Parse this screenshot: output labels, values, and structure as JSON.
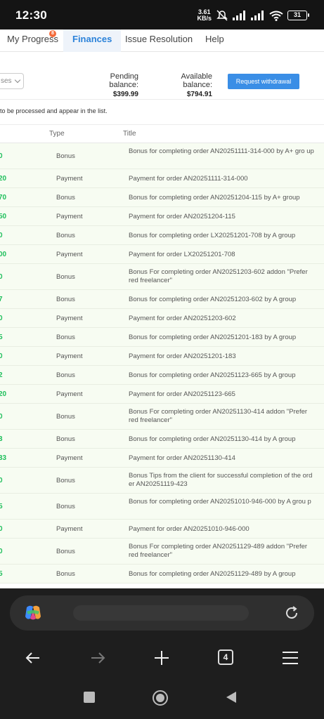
{
  "status_bar": {
    "time": "12:30",
    "net_speed_value": "3.61",
    "net_speed_unit": "KB/s",
    "battery": "31"
  },
  "nav": {
    "tabs": [
      {
        "label": "My Progress",
        "badge": "8"
      },
      {
        "label": "Finances"
      },
      {
        "label": "Issue Resolution"
      },
      {
        "label": "Help"
      }
    ],
    "active": "Finances"
  },
  "balance": {
    "select_value": "ses",
    "pending_label": "Pending balance:",
    "pending_value": "$399.99",
    "available_label": "Available balance:",
    "available_value": "$794.91",
    "withdraw_label": "Request withdrawal"
  },
  "notice": "to be processed and appear in the list.",
  "table": {
    "headers": {
      "type": "Type",
      "title": "Title"
    },
    "rows": [
      {
        "amount": "0",
        "type": "Bonus",
        "title": "Bonus for completing order AN20251111-314-000 by A+ gro up"
      },
      {
        "amount": "20",
        "type": "Payment",
        "title": "Payment for order AN20251111-314-000"
      },
      {
        "amount": "70",
        "type": "Bonus",
        "title": "Bonus for completing order AN20251204-115 by A+ group"
      },
      {
        "amount": "50",
        "type": "Payment",
        "title": "Payment for order AN20251204-115"
      },
      {
        "amount": "0",
        "type": "Bonus",
        "title": "Bonus for completing order LX20251201-708 by A group"
      },
      {
        "amount": "00",
        "type": "Payment",
        "title": "Payment for order LX20251201-708"
      },
      {
        "amount": "0",
        "type": "Bonus",
        "title": "Bonus For completing order AN20251203-602 addon \"Prefer red freelancer\""
      },
      {
        "amount": "7",
        "type": "Bonus",
        "title": "Bonus for completing order AN20251203-602 by A group"
      },
      {
        "amount": "0",
        "type": "Payment",
        "title": "Payment for order AN20251203-602"
      },
      {
        "amount": "5",
        "type": "Bonus",
        "title": "Bonus for completing order AN20251201-183 by A group"
      },
      {
        "amount": "0",
        "type": "Payment",
        "title": "Payment for order AN20251201-183"
      },
      {
        "amount": "2",
        "type": "Bonus",
        "title": "Bonus for completing order AN20251123-665 by A group"
      },
      {
        "amount": "20",
        "type": "Payment",
        "title": "Payment for order AN20251123-665"
      },
      {
        "amount": "0",
        "type": "Bonus",
        "title": "Bonus For completing order AN20251130-414 addon \"Prefer red freelancer\""
      },
      {
        "amount": "3",
        "type": "Bonus",
        "title": "Bonus for completing order AN20251130-414 by A group"
      },
      {
        "amount": "33",
        "type": "Payment",
        "title": "Payment for order AN20251130-414"
      },
      {
        "amount": "0",
        "type": "Bonus",
        "title": "Bonus Tips from the client for successful completion of the ord er AN20251119-423"
      },
      {
        "amount": "5",
        "type": "Bonus",
        "title": "Bonus for completing order AN20251010-946-000 by A grou p"
      },
      {
        "amount": "0",
        "type": "Payment",
        "title": "Payment for order AN20251010-946-000"
      },
      {
        "amount": "0",
        "type": "Bonus",
        "title": "Bonus For completing order AN20251129-489 addon \"Prefer red freelancer\""
      },
      {
        "amount": "5",
        "type": "Bonus",
        "title": "Bonus for completing order AN20251129-489 by A group"
      }
    ]
  },
  "browser": {
    "tab_count": "4"
  },
  "colors": {
    "accent": "#2b82d9",
    "amount_green": "#1fbf5c",
    "row_bg": "#f7fcf2",
    "button_blue": "#3a8ee6"
  }
}
